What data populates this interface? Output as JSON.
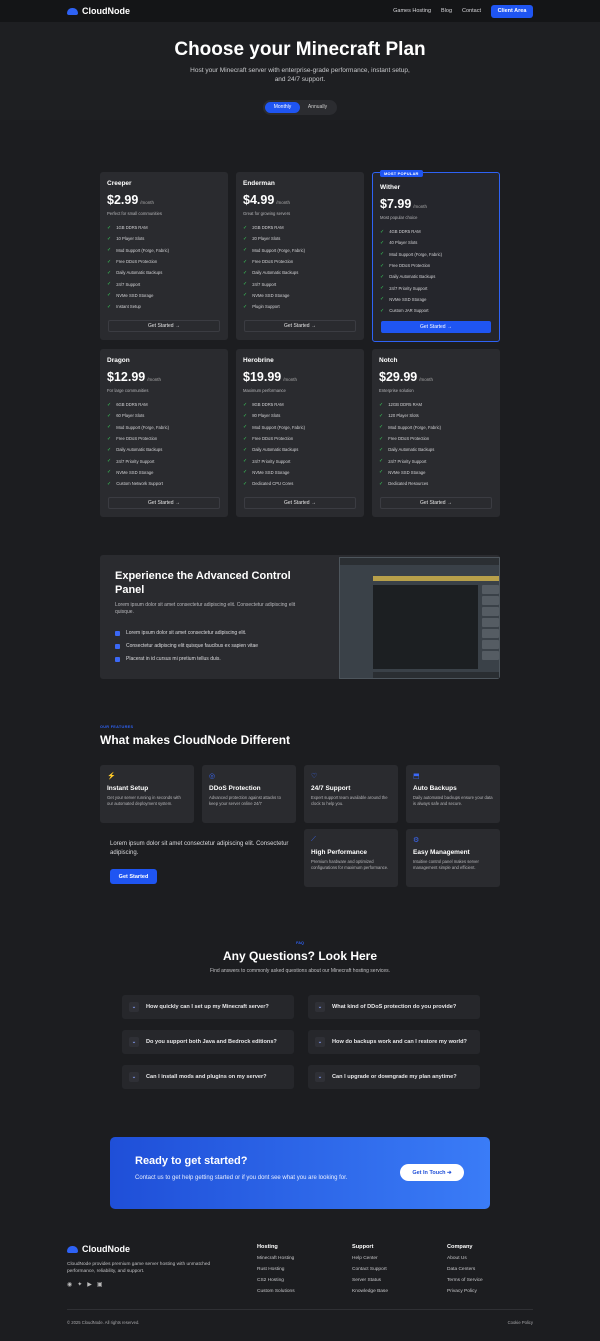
{
  "nav": {
    "brand": "CloudNode",
    "links": [
      "Games Hosting",
      "Blog",
      "Contact"
    ],
    "client_btn": "Client Area"
  },
  "hero": {
    "title": "Choose your Minecraft Plan",
    "subtitle": "Host your Minecraft server with enterprise-grade performance, instant setup, and 24/7 support.",
    "toggle": [
      "Monthly",
      "Annually"
    ]
  },
  "plans": [
    {
      "name": "Creeper",
      "price": "$2.99",
      "per": "/month",
      "desc": "Perfect for small communities",
      "cta": "Get Started →",
      "features": [
        "1GB DDR5 RAM",
        "10 Player Slots",
        "Mod Support (Forge, Fabric)",
        "Free DDoS Protection",
        "Daily Automatic Backups",
        "24/7 Support",
        "NVMe SSD Storage",
        "Instant Setup"
      ]
    },
    {
      "name": "Enderman",
      "price": "$4.99",
      "per": "/month",
      "desc": "Great for growing servers",
      "cta": "Get Started →",
      "features": [
        "2GB DDR5 RAM",
        "20 Player Slots",
        "Mod Support (Forge, Fabric)",
        "Free DDoS Protection",
        "Daily Automatic Backups",
        "24/7 Support",
        "NVMe SSD Storage",
        "Plugin Support"
      ]
    },
    {
      "name": "Wither",
      "price": "$7.99",
      "per": "/month",
      "desc": "Most popular choice",
      "badge": "MOST POPULAR",
      "cta": "Get Started →",
      "features": [
        "4GB DDR5 RAM",
        "40 Player Slots",
        "Mod Support (Forge, Fabric)",
        "Free DDoS Protection",
        "Daily Automatic Backups",
        "24/7 Priority Support",
        "NVMe SSD Storage",
        "Custom JAR Support"
      ]
    },
    {
      "name": "Dragon",
      "price": "$12.99",
      "per": "/month",
      "desc": "For large communities",
      "cta": "Get Started →",
      "features": [
        "6GB DDR5 RAM",
        "60 Player Slots",
        "Mod Support (Forge, Fabric)",
        "Free DDoS Protection",
        "Daily Automatic Backups",
        "24/7 Priority Support",
        "NVMe SSD Storage",
        "Custom Network Support"
      ]
    },
    {
      "name": "Herobrine",
      "price": "$19.99",
      "per": "/month",
      "desc": "Maximum performance",
      "cta": "Get Started →",
      "features": [
        "8GB DDR5 RAM",
        "80 Player Slots",
        "Mod Support (Forge, Fabric)",
        "Free DDoS Protection",
        "Daily Automatic Backups",
        "24/7 Priority Support",
        "NVMe SSD Storage",
        "Dedicated CPU Cores"
      ]
    },
    {
      "name": "Notch",
      "price": "$29.99",
      "per": "/month",
      "desc": "Enterprise solution",
      "cta": "Get Started →",
      "features": [
        "12GB DDR5 RAM",
        "120 Player Slots",
        "Mod Support (Forge, Fabric)",
        "Free DDoS Protection",
        "Daily Automatic Backups",
        "24/7 Priority Support",
        "NVMe SSD Storage",
        "Dedicated Resources"
      ]
    }
  ],
  "panel": {
    "title": "Experience the Advanced Control Panel",
    "sub": "Lorem ipsum dolor sit amet consectetur adipiscing elit. Consectetur adipiscing elit quisque.",
    "bullets": [
      "Lorem ipsum dolor sit amet consectetur adipiscing elit.",
      "Consectetur adipiscing elit quisque faucibus ex sapien vitae",
      "Placerat in id cursus mi pretium tellus duis."
    ]
  },
  "features": {
    "tag": "OUR FEATURES",
    "title": "What makes CloudNode Different",
    "items": [
      {
        "title": "Instant Setup",
        "text": "Get your server running in seconds with our automated deployment system."
      },
      {
        "title": "DDoS Protection",
        "text": "Advanced protection against attacks to keep your server online 24/7"
      },
      {
        "title": "24/7 Support",
        "text": "Expert support team available around the clock to help you."
      },
      {
        "title": "Auto Backups",
        "text": "Daily automated backups ensure your data is always safe and secure."
      },
      {
        "title": "High Performance",
        "text": "Premium hardware and optimized configurations for maximum performance."
      },
      {
        "title": "Easy Management",
        "text": "Intuitive control panel makes server management simple and efficient."
      }
    ],
    "cta_text": "Lorem ipsum dolor sit amet consectetur adipiscing elit. Consectetur adipiscing.",
    "cta_btn": "Get Started"
  },
  "faq": {
    "tag": "FAQ",
    "title": "Any Questions? Look Here",
    "sub": "Find answers to commonly asked questions about our Minecraft hosting services.",
    "questions": [
      "How quickly can I set up my Minecraft server?",
      "What kind of DDoS protection do you provide?",
      "Do you support both Java and Bedrock editions?",
      "How do backups work and can I restore my world?",
      "Can I install mods and plugins on my server?",
      "Can I upgrade or downgrade my plan anytime?"
    ]
  },
  "ready": {
    "title": "Ready to get started?",
    "text": "Contact us to get help getting started or if you dont see what you are looking for.",
    "btn": "Get In Touch ➔"
  },
  "footer": {
    "brand": "CloudNode",
    "about": "CloudNode provides premium game server hosting with unmatched performance, reliability, and support.",
    "cols": [
      {
        "title": "Hosting",
        "links": [
          "Minecraft Hosting",
          "Rust Hosting",
          "CS2 Hosting",
          "Custom Solutions"
        ]
      },
      {
        "title": "Support",
        "links": [
          "Help Center",
          "Contact Support",
          "Server Status",
          "Knowledge Base"
        ]
      },
      {
        "title": "Company",
        "links": [
          "About Us",
          "Data Centers",
          "Terms of Service",
          "Privacy Policy"
        ]
      }
    ],
    "copyright": "© 2025 CloudNode. All rights reserved.",
    "cookie": "Cookie Policy"
  }
}
